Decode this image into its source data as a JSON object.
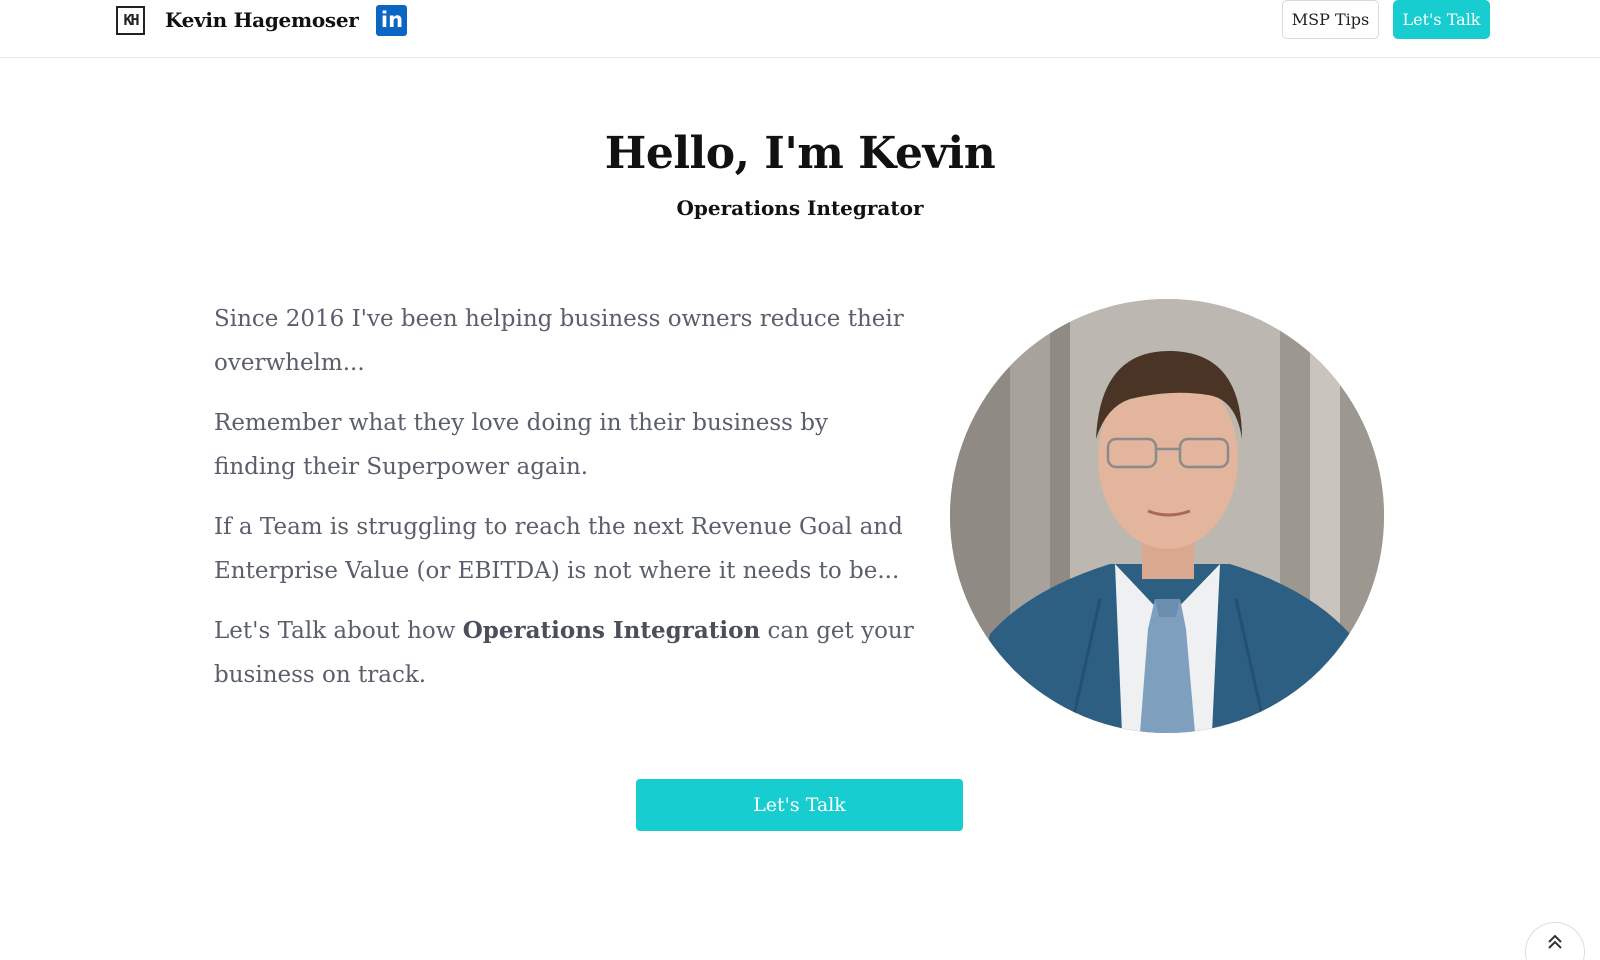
{
  "header": {
    "logo_text": "KH",
    "brand_name": "Kevin Hagemoser",
    "linkedin_label": "in",
    "nav": {
      "msp_tips_label": "MSP Tips",
      "lets_talk_label": "Let's Talk"
    }
  },
  "hero": {
    "title": "Hello, I'm Kevin",
    "subtitle": "Operations Integrator"
  },
  "about": {
    "p1": "Since 2016 I've been helping business owners reduce their overwhelm...",
    "p2": "Remember what they love doing in their business by finding their Superpower again.",
    "p3": "If a Team is struggling to reach the next Revenue Goal and Enterprise Value (or EBITDA) is not where it needs to be...",
    "p4_before": "Let's Talk about how ",
    "p4_strong": "Operations Integration",
    "p4_after": " can get your business on track."
  },
  "cta": {
    "label": "Let's Talk"
  },
  "icons": {
    "logo": "kh-logo-icon",
    "linkedin": "linkedin-icon",
    "scroll_top": "double-chevron-up-icon"
  },
  "colors": {
    "accent": "#17cdcf",
    "linkedin": "#0a66c2",
    "body_text": "#5a5f6b"
  }
}
